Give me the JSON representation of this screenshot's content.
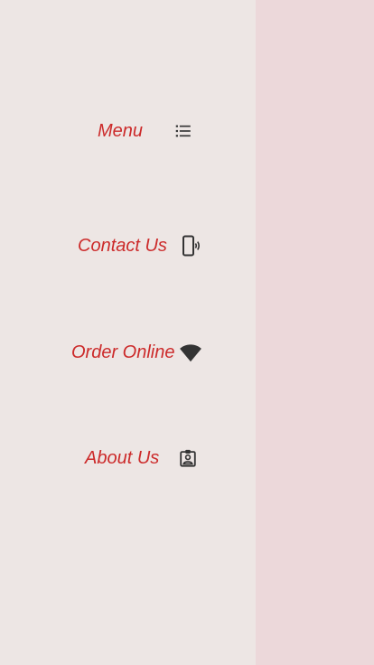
{
  "nav_drawer": {
    "items": [
      {
        "label": "Menu",
        "icon": "list-icon"
      },
      {
        "label": "Contact Us",
        "icon": "phone-ringing-icon"
      },
      {
        "label": "Order Online",
        "icon": "wifi-icon"
      },
      {
        "label": "About Us",
        "icon": "contact-badge-icon"
      }
    ]
  },
  "colors": {
    "drawer_background": "#ede6e4",
    "scrim": "#ecd8da",
    "label": "#cc2a2a",
    "icon": "#333333"
  }
}
